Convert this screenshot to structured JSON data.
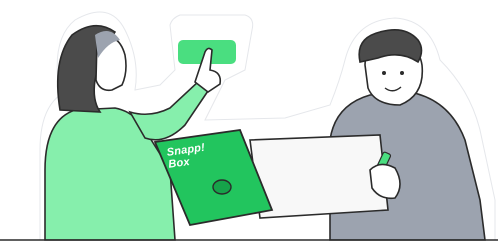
{
  "illustration": {
    "box_brand_line1": "Snapp!",
    "box_brand_line2": "Box"
  },
  "colors": {
    "accent_green": "#4ade80",
    "bright_green": "#22c55e",
    "light_green": "#86efac",
    "hoodie_gray": "#9ca3af",
    "hair_dark": "#4b4b4b",
    "outline": "#2b2b2b"
  },
  "icons": [
    "floating-button-icon",
    "pencil-icon"
  ]
}
